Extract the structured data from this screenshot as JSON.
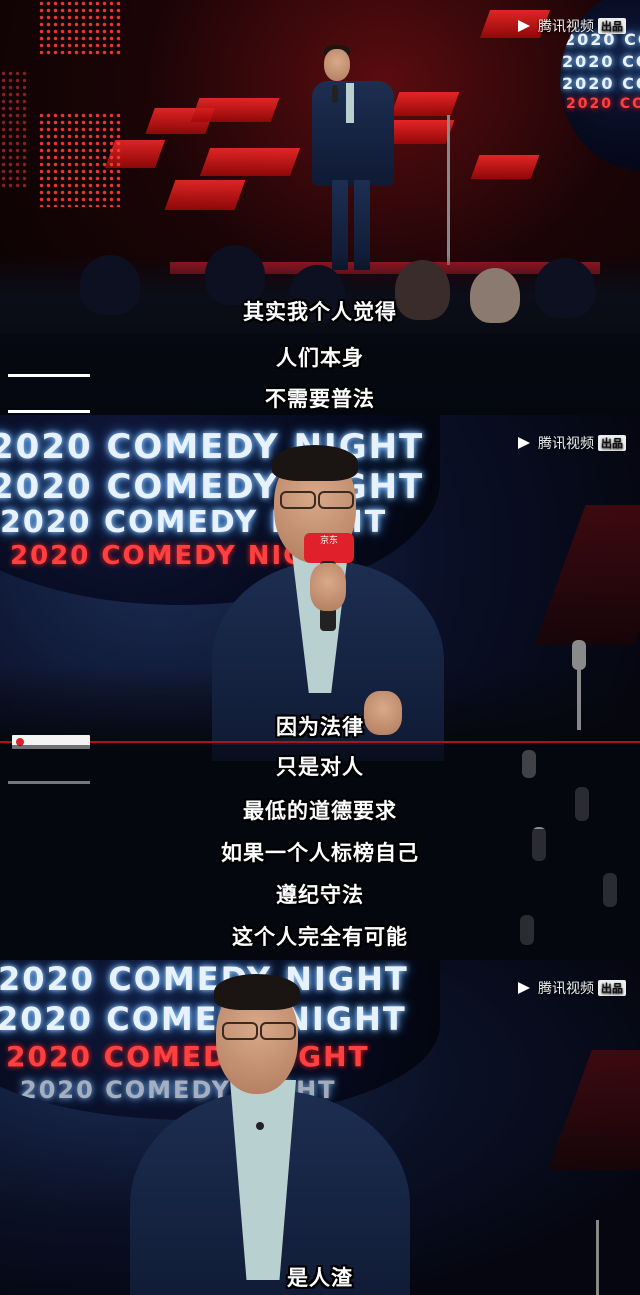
{
  "watermark": {
    "brand": "腾讯视频",
    "badge": "出品",
    "icon": "play-triangle-icon"
  },
  "stage_text": {
    "line1": "2020 COMEDY NIGHT",
    "line2": "2020 COMEDY NIGHT",
    "line3": "2020 COMEDY NIGHT",
    "line4": "2020 COMEDY NIGHT"
  },
  "mic_flag": "京东",
  "subtitles": {
    "frame1": [
      "其实我个人觉得",
      "人们本身",
      "不需要普法"
    ],
    "frame2": [
      "因为法律",
      "只是对人",
      "最低的道德要求",
      "如果一个人标榜自己",
      "遵纪守法",
      "这个人完全有可能"
    ],
    "frame3": [
      "是人渣"
    ]
  },
  "colors": {
    "stage_red": "#d01e2a",
    "neon_white": "#e8f2ff",
    "neon_red": "#ff4040",
    "suit_navy": "#1d2e52"
  }
}
